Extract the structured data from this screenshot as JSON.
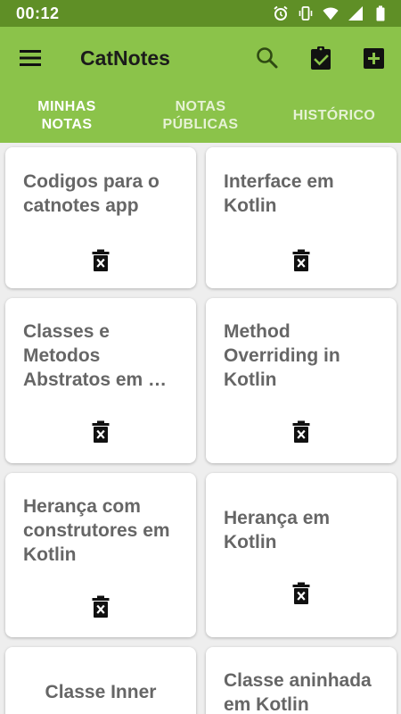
{
  "status": {
    "time": "00:12"
  },
  "app": {
    "title": "CatNotes"
  },
  "tabs": [
    {
      "label": "MINHAS\nNOTAS"
    },
    {
      "label": "NOTAS\nPÚBLICAS"
    },
    {
      "label": "HISTÓRICO"
    }
  ],
  "notes": [
    {
      "title": "Codigos para o catnotes app"
    },
    {
      "title": "Interface em Kotlin"
    },
    {
      "title": "Classes e Metodos Abstratos em …"
    },
    {
      "title": "Method Overriding in Kotlin"
    },
    {
      "title": "Herança com construtores em Kotlin"
    },
    {
      "title": "Herança em Kotlin"
    },
    {
      "title": "Classe Inner"
    },
    {
      "title": "Classe aninhada em Kotlin"
    }
  ],
  "icons": {
    "menu": "hamburger-menu",
    "search": "magnifier",
    "clipboard": "clipboard-check",
    "add": "plus-box",
    "delete": "trash-can-x"
  },
  "colors": {
    "primary": "#8bc34a",
    "status_bar": "#5f8f26",
    "note_text": "#666666"
  }
}
